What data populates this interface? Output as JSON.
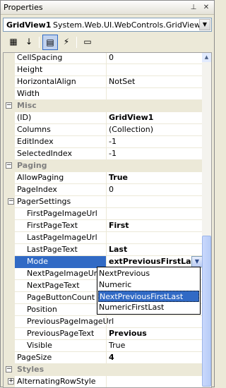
{
  "window": {
    "title": "Properties",
    "pin_glyph": "⊥",
    "close_glyph": "✕"
  },
  "selector": {
    "name": "GridView1",
    "type": "System.Web.UI.WebControls.GridView",
    "arrow": "▼"
  },
  "toolbar": {
    "categorized": "▦",
    "alphabetical": "↓",
    "properties": "▤",
    "events": "⚡",
    "property_pages": "▭"
  },
  "rows": [
    {
      "kind": "prop",
      "indent": 1,
      "name": "CellSpacing",
      "value": "0",
      "bold": false
    },
    {
      "kind": "prop",
      "indent": 1,
      "name": "Height",
      "value": "",
      "bold": false
    },
    {
      "kind": "prop",
      "indent": 1,
      "name": "HorizontalAlign",
      "value": "NotSet",
      "bold": false
    },
    {
      "kind": "prop",
      "indent": 1,
      "name": "Width",
      "value": "",
      "bold": false
    },
    {
      "kind": "cat",
      "name": "Misc",
      "toggle": "−"
    },
    {
      "kind": "prop",
      "indent": 1,
      "name": "(ID)",
      "value": "GridView1",
      "bold": true
    },
    {
      "kind": "prop",
      "indent": 1,
      "name": "Columns",
      "value": "(Collection)",
      "bold": false
    },
    {
      "kind": "prop",
      "indent": 1,
      "name": "EditIndex",
      "value": "-1",
      "bold": false
    },
    {
      "kind": "prop",
      "indent": 1,
      "name": "SelectedIndex",
      "value": "-1",
      "bold": false
    },
    {
      "kind": "cat",
      "name": "Paging",
      "toggle": "−"
    },
    {
      "kind": "prop",
      "indent": 1,
      "name": "AllowPaging",
      "value": "True",
      "bold": true
    },
    {
      "kind": "prop",
      "indent": 1,
      "name": "PageIndex",
      "value": "0",
      "bold": false
    },
    {
      "kind": "expand",
      "indent": 1,
      "name": "PagerSettings",
      "value": "",
      "bold": false,
      "toggle": "−"
    },
    {
      "kind": "prop",
      "indent": 2,
      "name": "FirstPageImageUrl",
      "value": "",
      "bold": false
    },
    {
      "kind": "prop",
      "indent": 2,
      "name": "FirstPageText",
      "value": "First",
      "bold": true
    },
    {
      "kind": "prop",
      "indent": 2,
      "name": "LastPageImageUrl",
      "value": "",
      "bold": false
    },
    {
      "kind": "prop",
      "indent": 2,
      "name": "LastPageText",
      "value": "Last",
      "bold": true
    },
    {
      "kind": "selected",
      "indent": 2,
      "name": "Mode",
      "value": "extPreviousFirstLast",
      "bold": true,
      "dropdown": "▼"
    },
    {
      "kind": "prop",
      "indent": 2,
      "name": "NextPageImageUrl",
      "value": "",
      "bold": false
    },
    {
      "kind": "prop",
      "indent": 2,
      "name": "NextPageText",
      "value": "",
      "bold": false
    },
    {
      "kind": "prop",
      "indent": 2,
      "name": "PageButtonCount",
      "value": "",
      "bold": false
    },
    {
      "kind": "prop",
      "indent": 2,
      "name": "Position",
      "value": "",
      "bold": false
    },
    {
      "kind": "prop",
      "indent": 2,
      "name": "PreviousPageImageUrl",
      "value": "",
      "bold": false
    },
    {
      "kind": "prop",
      "indent": 2,
      "name": "PreviousPageText",
      "value": "Previous",
      "bold": true
    },
    {
      "kind": "prop",
      "indent": 2,
      "name": "Visible",
      "value": "True",
      "bold": false
    },
    {
      "kind": "prop",
      "indent": 1,
      "name": "PageSize",
      "value": "4",
      "bold": true
    },
    {
      "kind": "cat",
      "name": "Styles",
      "toggle": "−"
    },
    {
      "kind": "expand",
      "indent": 1,
      "name": "AlternatingRowStyle",
      "value": "",
      "bold": false,
      "toggle": "+"
    }
  ],
  "dropdown": {
    "options": [
      "NextPrevious",
      "Numeric",
      "NextPreviousFirstLast",
      "NumericFirstLast"
    ],
    "highlighted_index": 2
  },
  "scrollbar": {
    "up": "▲",
    "down": "▼"
  },
  "colors": {
    "selection": "#316ac5",
    "category_text": "#808080",
    "panel_bg": "#ece9d8"
  }
}
